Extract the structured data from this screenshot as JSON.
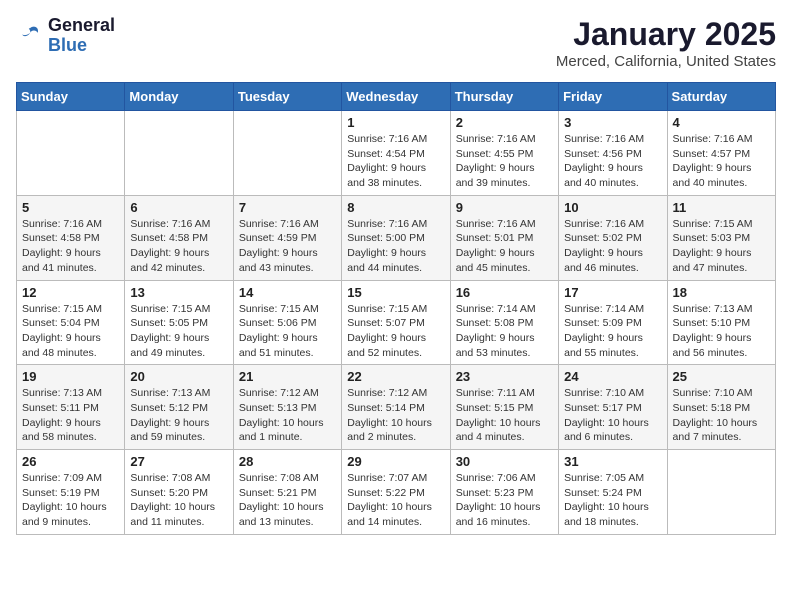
{
  "logo": {
    "text_general": "General",
    "text_blue": "Blue"
  },
  "header": {
    "title": "January 2025",
    "location": "Merced, California, United States"
  },
  "weekdays": [
    "Sunday",
    "Monday",
    "Tuesday",
    "Wednesday",
    "Thursday",
    "Friday",
    "Saturday"
  ],
  "weeks": [
    [
      null,
      null,
      null,
      {
        "day": "1",
        "sunrise": "7:16 AM",
        "sunset": "4:54 PM",
        "daylight": "9 hours and 38 minutes."
      },
      {
        "day": "2",
        "sunrise": "7:16 AM",
        "sunset": "4:55 PM",
        "daylight": "9 hours and 39 minutes."
      },
      {
        "day": "3",
        "sunrise": "7:16 AM",
        "sunset": "4:56 PM",
        "daylight": "9 hours and 40 minutes."
      },
      {
        "day": "4",
        "sunrise": "7:16 AM",
        "sunset": "4:57 PM",
        "daylight": "9 hours and 40 minutes."
      }
    ],
    [
      {
        "day": "5",
        "sunrise": "7:16 AM",
        "sunset": "4:58 PM",
        "daylight": "9 hours and 41 minutes."
      },
      {
        "day": "6",
        "sunrise": "7:16 AM",
        "sunset": "4:58 PM",
        "daylight": "9 hours and 42 minutes."
      },
      {
        "day": "7",
        "sunrise": "7:16 AM",
        "sunset": "4:59 PM",
        "daylight": "9 hours and 43 minutes."
      },
      {
        "day": "8",
        "sunrise": "7:16 AM",
        "sunset": "5:00 PM",
        "daylight": "9 hours and 44 minutes."
      },
      {
        "day": "9",
        "sunrise": "7:16 AM",
        "sunset": "5:01 PM",
        "daylight": "9 hours and 45 minutes."
      },
      {
        "day": "10",
        "sunrise": "7:16 AM",
        "sunset": "5:02 PM",
        "daylight": "9 hours and 46 minutes."
      },
      {
        "day": "11",
        "sunrise": "7:15 AM",
        "sunset": "5:03 PM",
        "daylight": "9 hours and 47 minutes."
      }
    ],
    [
      {
        "day": "12",
        "sunrise": "7:15 AM",
        "sunset": "5:04 PM",
        "daylight": "9 hours and 48 minutes."
      },
      {
        "day": "13",
        "sunrise": "7:15 AM",
        "sunset": "5:05 PM",
        "daylight": "9 hours and 49 minutes."
      },
      {
        "day": "14",
        "sunrise": "7:15 AM",
        "sunset": "5:06 PM",
        "daylight": "9 hours and 51 minutes."
      },
      {
        "day": "15",
        "sunrise": "7:15 AM",
        "sunset": "5:07 PM",
        "daylight": "9 hours and 52 minutes."
      },
      {
        "day": "16",
        "sunrise": "7:14 AM",
        "sunset": "5:08 PM",
        "daylight": "9 hours and 53 minutes."
      },
      {
        "day": "17",
        "sunrise": "7:14 AM",
        "sunset": "5:09 PM",
        "daylight": "9 hours and 55 minutes."
      },
      {
        "day": "18",
        "sunrise": "7:13 AM",
        "sunset": "5:10 PM",
        "daylight": "9 hours and 56 minutes."
      }
    ],
    [
      {
        "day": "19",
        "sunrise": "7:13 AM",
        "sunset": "5:11 PM",
        "daylight": "9 hours and 58 minutes."
      },
      {
        "day": "20",
        "sunrise": "7:13 AM",
        "sunset": "5:12 PM",
        "daylight": "9 hours and 59 minutes."
      },
      {
        "day": "21",
        "sunrise": "7:12 AM",
        "sunset": "5:13 PM",
        "daylight": "10 hours and 1 minute."
      },
      {
        "day": "22",
        "sunrise": "7:12 AM",
        "sunset": "5:14 PM",
        "daylight": "10 hours and 2 minutes."
      },
      {
        "day": "23",
        "sunrise": "7:11 AM",
        "sunset": "5:15 PM",
        "daylight": "10 hours and 4 minutes."
      },
      {
        "day": "24",
        "sunrise": "7:10 AM",
        "sunset": "5:17 PM",
        "daylight": "10 hours and 6 minutes."
      },
      {
        "day": "25",
        "sunrise": "7:10 AM",
        "sunset": "5:18 PM",
        "daylight": "10 hours and 7 minutes."
      }
    ],
    [
      {
        "day": "26",
        "sunrise": "7:09 AM",
        "sunset": "5:19 PM",
        "daylight": "10 hours and 9 minutes."
      },
      {
        "day": "27",
        "sunrise": "7:08 AM",
        "sunset": "5:20 PM",
        "daylight": "10 hours and 11 minutes."
      },
      {
        "day": "28",
        "sunrise": "7:08 AM",
        "sunset": "5:21 PM",
        "daylight": "10 hours and 13 minutes."
      },
      {
        "day": "29",
        "sunrise": "7:07 AM",
        "sunset": "5:22 PM",
        "daylight": "10 hours and 14 minutes."
      },
      {
        "day": "30",
        "sunrise": "7:06 AM",
        "sunset": "5:23 PM",
        "daylight": "10 hours and 16 minutes."
      },
      {
        "day": "31",
        "sunrise": "7:05 AM",
        "sunset": "5:24 PM",
        "daylight": "10 hours and 18 minutes."
      },
      null
    ]
  ]
}
